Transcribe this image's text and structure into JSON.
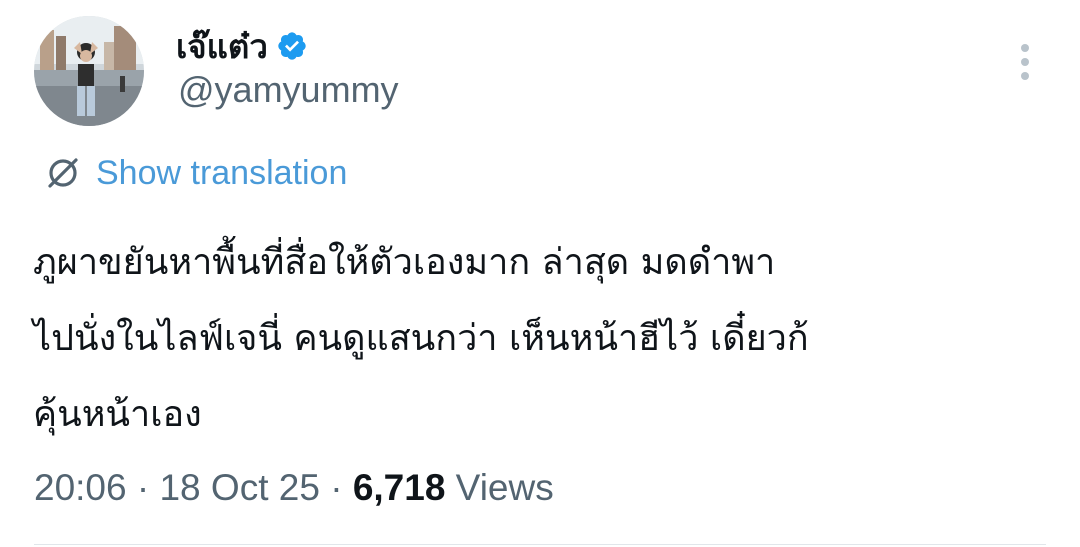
{
  "author": {
    "display_name": "เจ๊แต๋ว",
    "handle": "@yamyummy",
    "verified": true,
    "verified_color": "#1d9bf0"
  },
  "translation": {
    "label": "Show translation",
    "icon": "translate-icon",
    "color": "#4a9ad8"
  },
  "tweet": {
    "lines": [
      "ภูผาขยันหาพื้นที่สื่อให้ตัวเองมาก ล่าสุด มดดำพา",
      "ไปนั่งในไลฟ์เจนี่ คนดูแสนกว่า เห็นหน้าฮีไว้ เดี๋ยวก้",
      "คุ้นหน้าเอง"
    ]
  },
  "meta": {
    "time": "20:06",
    "separator_1": " · ",
    "date": "18 Oct 25",
    "separator_2": " · ",
    "views_count": "6,718",
    "views_label": " Views"
  },
  "more_icon": "more-vertical-icon"
}
